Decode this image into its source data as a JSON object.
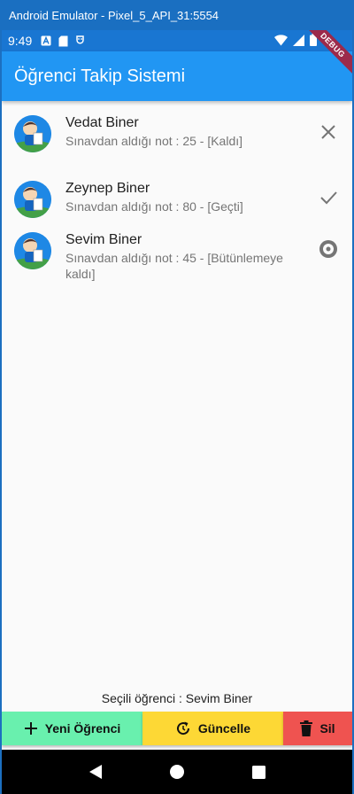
{
  "window": {
    "title": "Android Emulator - Pixel_5_API_31:5554"
  },
  "status_bar": {
    "time": "9:49",
    "icons": [
      "a-icon",
      "sd-card-icon",
      "usb-icon"
    ],
    "right_icons": [
      "wifi-icon",
      "signal-icon",
      "battery-icon"
    ]
  },
  "debug_banner": {
    "label": "DEBUG"
  },
  "app_bar": {
    "title": "Öğrenci Takip Sistemi"
  },
  "students": [
    {
      "name": "Vedat Biner",
      "subtitle": "Sınavdan aldığı not : 25 - [Kaldı]",
      "icon": "close-icon"
    },
    {
      "name": "Zeynep Biner",
      "subtitle": "Sınavdan aldığı not : 80 - [Geçti]",
      "icon": "check-icon"
    },
    {
      "name": "Sevim  Biner",
      "subtitle": "Sınavdan aldığı not : 45 - [Bütünlemeye kaldı]",
      "icon": "radio-icon"
    }
  ],
  "selected": {
    "label": "Seçili öğrenci : Sevim  Biner"
  },
  "buttons": {
    "new_label": "Yeni Öğrenci",
    "update_label": "Güncelle",
    "delete_label": "Sil",
    "colors": {
      "new": "#69f0ae",
      "update": "#fdd835",
      "delete": "#ef5350"
    }
  },
  "colors": {
    "app_bar": "#2196f3",
    "status_bar": "#1976d2"
  }
}
